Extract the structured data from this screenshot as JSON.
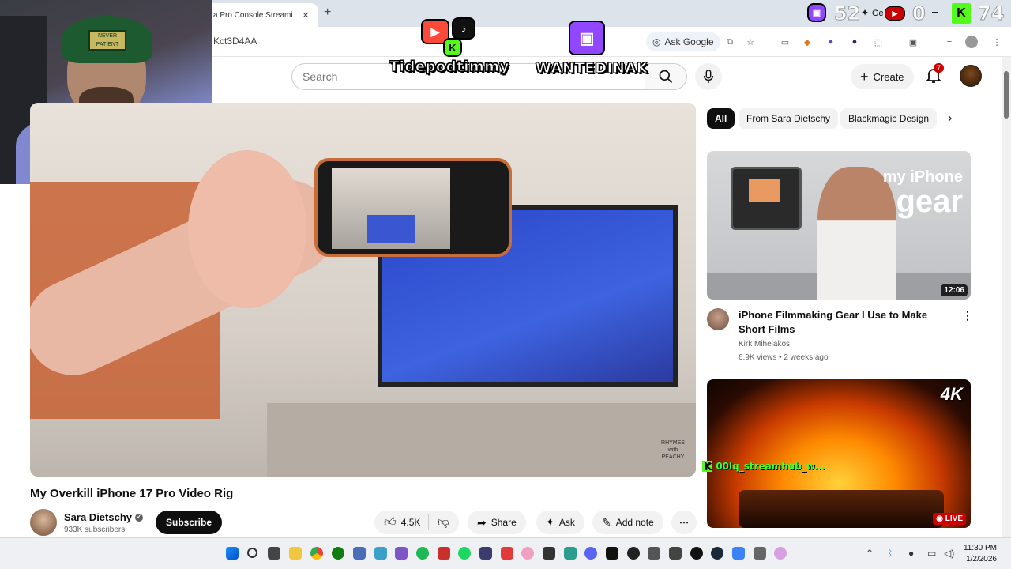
{
  "browser": {
    "tab_title": "a Pro Console Streami",
    "tab_close": "✕",
    "new_tab": "+",
    "url": "Kct3D4AA",
    "ask_google": "Ask Google",
    "window_partial_title": "Ge"
  },
  "overlay": {
    "name_left": "Tidepodtimmy",
    "name_right": "WANTEDINAK",
    "counter_twitch": "52",
    "counter_youtube": "0",
    "counter_kick": "74",
    "webcam_cap_text": "NEVER PATIENT",
    "chat_user": "00lq_streamhub_w..."
  },
  "youtube": {
    "search_placeholder": "Search",
    "create_label": "Create",
    "notif_count": "7"
  },
  "video": {
    "title": "My Overkill iPhone 17 Pro Video Rig",
    "watermark": "RHYMES with PEACHY",
    "channel": "Sara Dietschy",
    "subscribers": "933K subscribers",
    "subscribe": "Subscribe",
    "likes": "4.5K",
    "share": "Share",
    "ask": "Ask",
    "add_note": "Add note",
    "more": "⋯"
  },
  "chips": [
    "All",
    "From Sara Dietschy",
    "Blackmagic Design"
  ],
  "recommendations": [
    {
      "title": "iPhone Filmmaking Gear I Use to Make Short Films",
      "channel": "Kirk Mihelakos",
      "meta": "6.9K views • 2 weeks ago",
      "duration": "12:06",
      "thumb_text_top": "my iPhone",
      "thumb_text_bottom": "gear"
    },
    {
      "badge": "4K",
      "live": "LIVE"
    }
  ],
  "taskbar": {
    "time": "11:30 PM",
    "date": "1/2/2026"
  },
  "colors": {
    "youtube_red": "#cc0000",
    "twitch_purple": "#9146ff",
    "kick_green": "#53fc18"
  }
}
